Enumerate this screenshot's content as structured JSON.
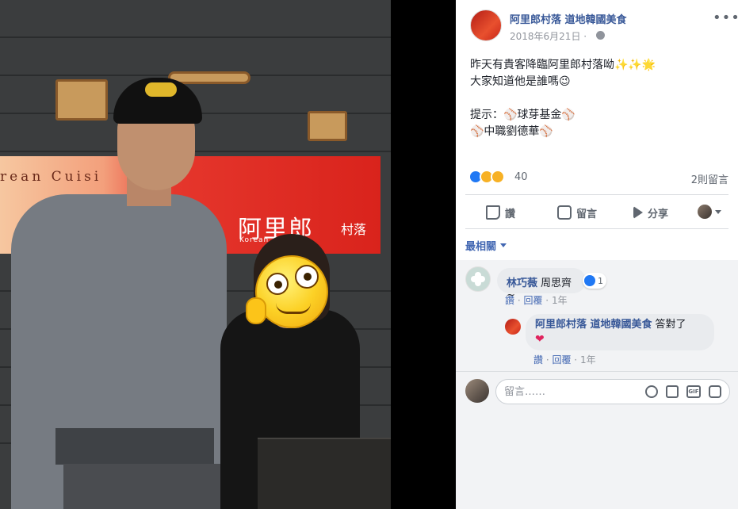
{
  "photo": {
    "sign_en": "rean  Cuisi",
    "sign_cn": "阿里郎",
    "sign_cn_small": "村落",
    "sign_ko": "Korean"
  },
  "post": {
    "page_name": "阿里郎村落 道地韓國美食",
    "date": "2018年6月21日 ·",
    "text": "昨天有貴客降臨阿里郎村落呦✨✨🌟\n大家知道他是誰嗎😉\n\n提示：⚾球芽基金⚾\n⚾中職劉德華⚾",
    "reactions_count": "40",
    "comments_count": "2則留言",
    "more_glyph": "•••"
  },
  "actions": {
    "like": "讚",
    "comment": "留言",
    "share": "分享"
  },
  "sort": {
    "label": "最相關"
  },
  "comments": [
    {
      "author": "林巧薇",
      "text": "周思齊~",
      "reaction_count": "1",
      "like": "讚",
      "reply": "回覆",
      "time": "1年"
    },
    {
      "author": "阿里郎村落 道地韓國美食",
      "text": "答對了",
      "like": "讚",
      "reply": "回覆",
      "time": "1年"
    }
  ],
  "composer": {
    "placeholder": "留言……",
    "gif": "GIF"
  },
  "colors": {
    "link": "#385898",
    "accent": "#4267b2",
    "meta": "#90949c",
    "sign_red": "#d9231c"
  }
}
